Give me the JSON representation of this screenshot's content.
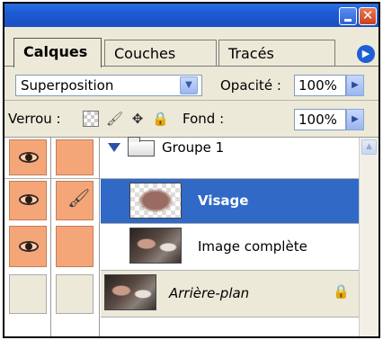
{
  "window": {
    "minimize_glyph": "",
    "close_glyph": "✕"
  },
  "tabs": [
    {
      "label": "Calques",
      "active": true
    },
    {
      "label": "Couches",
      "active": false
    },
    {
      "label": "Tracés",
      "active": false
    }
  ],
  "tabs_menu_glyph": "▶",
  "blend": {
    "mode": "Superposition",
    "opacity_label": "Opacité :",
    "opacity_value": "100%"
  },
  "lock": {
    "label": "Verrou :",
    "fond_label": "Fond :",
    "fond_value": "100%"
  },
  "layers": [
    {
      "name": "Groupe 1",
      "type": "group",
      "visible": true,
      "linked_brush": false,
      "selected": false,
      "italic": false
    },
    {
      "name": "Visage",
      "type": "layer",
      "visible": true,
      "linked_brush": true,
      "selected": true,
      "italic": false
    },
    {
      "name": "Image complète",
      "type": "layer",
      "visible": true,
      "linked_brush": false,
      "selected": false,
      "italic": false
    },
    {
      "name": "Arrière-plan",
      "type": "background",
      "visible": false,
      "linked_brush": false,
      "selected": false,
      "italic": true,
      "locked": true
    }
  ],
  "colors": {
    "selected_row": "#3169c6",
    "visible_cell": "#f4a679",
    "titlebar": "#1d5ad4"
  },
  "icons": {
    "eye": "eye-icon",
    "brush": "brush-icon",
    "lock": "🔒",
    "move": "✥",
    "paint": "🖌"
  }
}
